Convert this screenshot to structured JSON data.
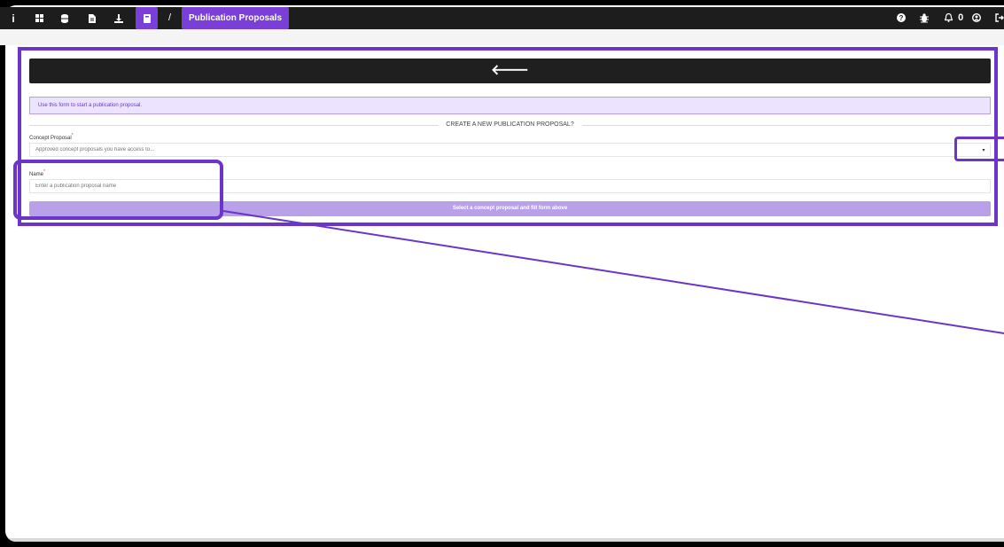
{
  "colors": {
    "accent": "#7a3fd6",
    "topbar": "#1d1d1d",
    "highlight": "#6b35c9"
  },
  "topbar": {
    "icons": [
      "info-icon",
      "grid-icon",
      "database-icon",
      "document-icon",
      "download-icon",
      "book-icon"
    ],
    "info_glyph": "i",
    "crumb_separator": "/",
    "page_title": "Publication Proposals",
    "notifications_count": "0"
  },
  "main": {
    "back_glyph": "🡐",
    "notice": "Use this form to start a publication proposal.",
    "heading": "CREATE A NEW PUBLICATION PROPOSAL?",
    "concept": {
      "label": "Concept Proposal",
      "required_mark": "*",
      "placeholder": "Approved concept proposals you have access to..."
    },
    "name": {
      "label": "Name",
      "required_mark": "*",
      "placeholder": "Enter a publication proposal name"
    },
    "submit_label": "Select a concept proposal and fill form above"
  }
}
